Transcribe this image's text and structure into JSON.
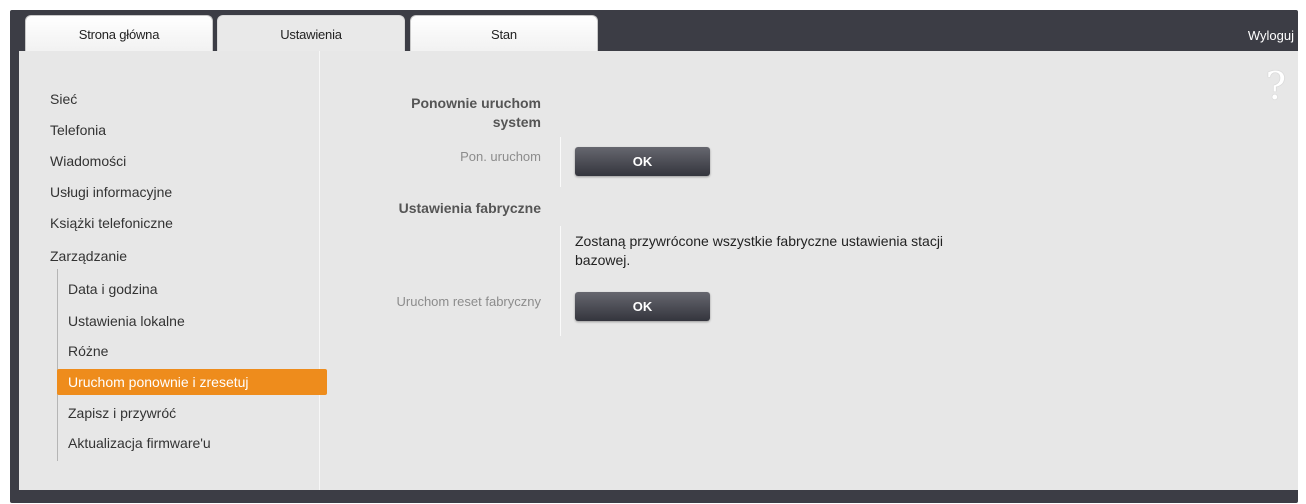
{
  "tabs": [
    {
      "label": "Strona główna"
    },
    {
      "label": "Ustawienia"
    },
    {
      "label": "Stan"
    }
  ],
  "header": {
    "logout_label": "Wyloguj",
    "help_label": "?"
  },
  "sidebar": {
    "items": [
      {
        "label": "Sieć"
      },
      {
        "label": "Telefonia"
      },
      {
        "label": "Wiadomości"
      },
      {
        "label": "Usługi informacyjne"
      },
      {
        "label": "Książki telefoniczne"
      },
      {
        "label": "Zarządzanie"
      }
    ],
    "subitems": [
      {
        "label": "Data i godzina"
      },
      {
        "label": "Ustawienia lokalne"
      },
      {
        "label": "Różne"
      },
      {
        "label": "Uruchom ponownie i zresetuj"
      },
      {
        "label": "Zapisz i przywróć"
      },
      {
        "label": "Aktualizacja firmware'u"
      }
    ]
  },
  "main": {
    "restart": {
      "title_line1": "Ponownie uruchom",
      "title_line2": "system",
      "label": "Pon. uruchom",
      "button": "OK"
    },
    "factory": {
      "title": "Ustawienia fabryczne",
      "desc_line1": "Zostaną przywrócone wszystkie fabryczne ustawienia stacji",
      "desc_line2": "bazowej.",
      "label": "Uruchom reset fabryczny",
      "button": "OK"
    }
  },
  "colors": {
    "accent": "#ee8c1c",
    "frame": "#3c3d45",
    "panel": "#e7e7e7"
  },
  "icons": {
    "help": "question-mark-icon"
  }
}
